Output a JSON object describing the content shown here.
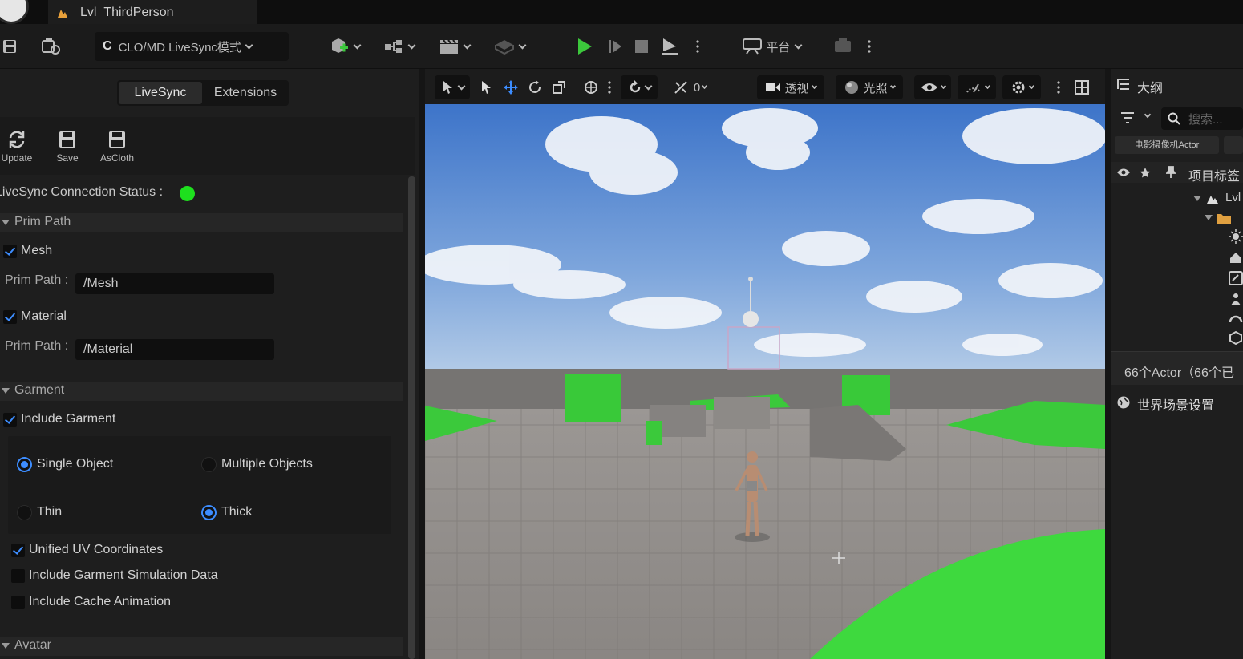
{
  "window": {
    "tab_title": "Lvl_ThirdPerson"
  },
  "toolbar": {
    "mode_label": "CLO/MD LiveSync模式",
    "mode_badge": "C",
    "platform_label": "平台"
  },
  "panel": {
    "tabs": [
      "LiveSync",
      "Extensions"
    ],
    "actions": [
      {
        "label": "Update",
        "icon": "refresh-icon"
      },
      {
        "label": "Save",
        "icon": "save-icon"
      },
      {
        "label": "AsCloth",
        "icon": "save-icon"
      }
    ],
    "connection_label": "LiveSync Connection Status :",
    "connection_color": "#1ee01e",
    "prim_section": "Prim Path",
    "mesh": {
      "label": "Mesh",
      "checked": true,
      "field_label": "Prim Path :",
      "value": "/Mesh"
    },
    "material": {
      "label": "Material",
      "checked": true,
      "field_label": "Prim Path :",
      "value": "/Material"
    },
    "garment_section": "Garment",
    "include_garment": {
      "label": "Include Garment",
      "checked": true
    },
    "object_mode": [
      {
        "label": "Single Object",
        "selected": true
      },
      {
        "label": "Multiple Objects",
        "selected": false
      }
    ],
    "thickness": [
      {
        "label": "Thin",
        "selected": false
      },
      {
        "label": "Thick",
        "selected": true
      }
    ],
    "options": [
      {
        "label": "Unified UV Coordinates",
        "checked": true
      },
      {
        "label": "Include Garment Simulation Data",
        "checked": false
      },
      {
        "label": "Include Cache Animation",
        "checked": false
      }
    ],
    "avatar_section": "Avatar"
  },
  "viewport": {
    "perspective_label": "透视",
    "lighting_label": "光照",
    "snap_value": "0"
  },
  "outliner": {
    "title": "大纲",
    "search_placeholder": "搜索...",
    "filter_chip": "电影摄像机Actor",
    "column_label": "项目标签",
    "tree_root": "Lvl",
    "actor_count": "66个Actor（66个已",
    "world_settings": "世界场景设置"
  },
  "colors": {
    "accent": "#3d8dff",
    "play": "#3cc83c",
    "ground_green": "#3ed93e"
  }
}
